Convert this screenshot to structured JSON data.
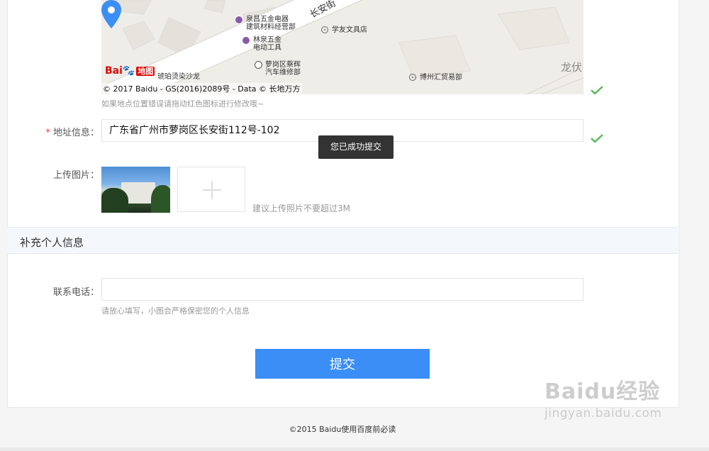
{
  "map": {
    "road_label": "长安街",
    "area_label": "龙伏",
    "pois": [
      {
        "text1": "泉昌五金电器",
        "text2": "建筑材料经营部"
      },
      {
        "text1": "林泉五金",
        "text2": "电动工具"
      },
      {
        "text1": "萝岗区蔡辉",
        "text2": "汽车维修部"
      },
      {
        "text1": "琥珀烫染沙龙"
      },
      {
        "text1": "学友文具店"
      },
      {
        "text1": "博州汇贸易部"
      }
    ],
    "logo_text": "Bai",
    "logo_map_text": "地图",
    "copyright": "© 2017 Baidu - GS(2016)2089号 - Data © 长地万方"
  },
  "map_hint": "如果地点位置错误请拖动红色图标进行修改哦~",
  "address": {
    "required_mark": "*",
    "label": "地址信息：",
    "value": "广东省广州市萝岗区长安街112号-102"
  },
  "toast": "您已成功提交",
  "upload": {
    "label": "上传图片：",
    "hint": "建议上传照片不要超过3M"
  },
  "section_title": "补充个人信息",
  "phone": {
    "label": "联系电话：",
    "value": "",
    "hint": "请放心填写，小图会严格保密您的个人信息"
  },
  "submit_label": "提交",
  "footer": "©2015 Baidu使用百度前必读",
  "watermark": {
    "line1": "Baidu经验",
    "line2": "jingyan.baidu.com"
  },
  "colors": {
    "accent": "#3a8ef6",
    "check": "#5cb85c",
    "required": "#e4393c"
  },
  "icons": [
    "location-pin-icon",
    "check-icon",
    "plus-icon"
  ]
}
